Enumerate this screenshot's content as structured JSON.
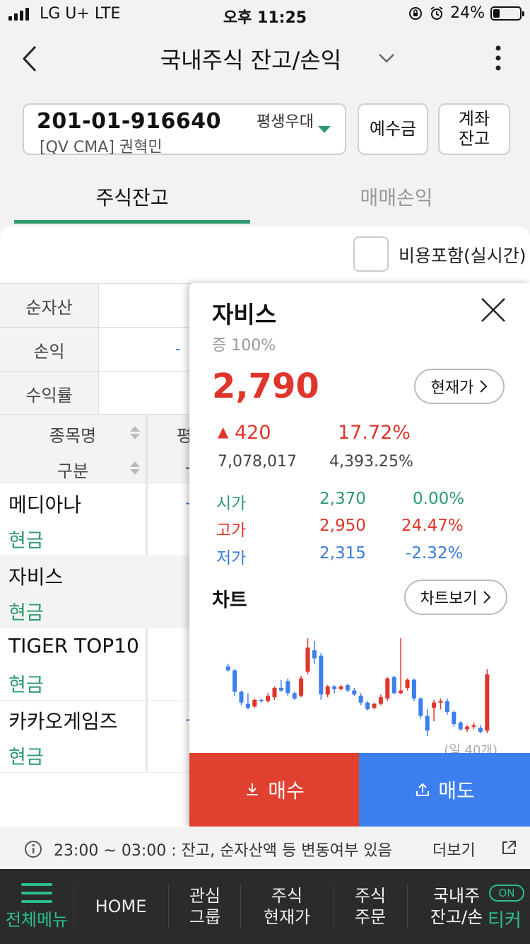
{
  "status_bar": {
    "carrier": "LG U+  LTE",
    "time": "오후 11:25",
    "battery": "24%",
    "battery_level": 0.24
  },
  "header": {
    "title": "국내주식 잔고/손익"
  },
  "account": {
    "number": "201-01-916640",
    "branch": "평생우대",
    "type_name": "[QV CMA]  권혁민",
    "deposit_btn": "예수금",
    "balance_btn": "계좌\n잔고"
  },
  "tabs": [
    {
      "label": "주식잔고",
      "active": true
    },
    {
      "label": "매매손익",
      "active": false
    }
  ],
  "include_fee_label": "비용포함(실시간)",
  "summary": [
    {
      "label": "순자산",
      "value": ""
    },
    {
      "label": "손익",
      "value": "-"
    },
    {
      "label": "수익률",
      "value": ""
    }
  ],
  "stock_table": {
    "header_name": "종목명",
    "header_type": "구분",
    "header_col2_a": "평",
    "header_col2_b": "-",
    "rows": [
      {
        "name": "메디아나",
        "type": "현금",
        "col2": "-"
      },
      {
        "name": "자비스",
        "type": "현금",
        "col2": ""
      },
      {
        "name": "TIGER TOP10",
        "type": "현금",
        "col2": ""
      },
      {
        "name": "카카오게임즈",
        "type": "현금",
        "col2": "-"
      }
    ]
  },
  "popup": {
    "name": "자비스",
    "margin": "증 100%",
    "price": "2,790",
    "current_btn": "현재가",
    "change": "420",
    "change_pct": "17.72%",
    "volume": "7,078,017",
    "volume_pct": "4,393.25%",
    "ohlc": [
      {
        "label": "시가",
        "value": "2,370",
        "pct": "0.00%",
        "color": "#2d9a6e"
      },
      {
        "label": "고가",
        "value": "2,950",
        "pct": "24.47%",
        "color": "#e0352b"
      },
      {
        "label": "저가",
        "value": "2,315",
        "pct": "-2.32%",
        "color": "#3a7be0"
      }
    ],
    "chart_title": "차트",
    "chart_btn": "차트보기",
    "chart_footer": "(일 40개)",
    "buy_btn": "매수",
    "sell_btn": "매도",
    "colors": {
      "up": "#e0352b",
      "down": "#3d7fef"
    }
  },
  "info": {
    "text": "23:00 ~ 03:00 : 잔고, 순자산액 등 변동여부 있음",
    "more": "더보기"
  },
  "bottom_nav": {
    "all_menu": "전체메뉴",
    "items": [
      "HOME",
      "관심\n그룹",
      "주식\n현재가",
      "주식\n주문",
      "국내주\n잔고/손"
    ],
    "on_badge": "ON",
    "ticker": "티커"
  },
  "chart_data": {
    "type": "candlestick",
    "period": "daily",
    "count": 40,
    "candles": [
      {
        "o": 2440,
        "h": 2460,
        "l": 2400,
        "c": 2410
      },
      {
        "o": 2410,
        "h": 2420,
        "l": 2220,
        "c": 2250
      },
      {
        "o": 2250,
        "h": 2260,
        "l": 2150,
        "c": 2170
      },
      {
        "o": 2160,
        "h": 2240,
        "l": 2120,
        "c": 2130
      },
      {
        "o": 2140,
        "h": 2200,
        "l": 2130,
        "c": 2190
      },
      {
        "o": 2190,
        "h": 2200,
        "l": 2170,
        "c": 2180
      },
      {
        "o": 2180,
        "h": 2240,
        "l": 2170,
        "c": 2220
      },
      {
        "o": 2210,
        "h": 2290,
        "l": 2190,
        "c": 2280
      },
      {
        "o": 2280,
        "h": 2340,
        "l": 2250,
        "c": 2260
      },
      {
        "o": 2330,
        "h": 2350,
        "l": 2220,
        "c": 2240
      },
      {
        "o": 2240,
        "h": 2250,
        "l": 2190,
        "c": 2200
      },
      {
        "o": 2220,
        "h": 2370,
        "l": 2210,
        "c": 2350
      },
      {
        "o": 2400,
        "h": 2650,
        "l": 2380,
        "c": 2580
      },
      {
        "o": 2560,
        "h": 2630,
        "l": 2460,
        "c": 2500
      },
      {
        "o": 2520,
        "h": 2540,
        "l": 2190,
        "c": 2230
      },
      {
        "o": 2230,
        "h": 2300,
        "l": 2210,
        "c": 2290
      },
      {
        "o": 2290,
        "h": 2300,
        "l": 2240,
        "c": 2270
      },
      {
        "o": 2270,
        "h": 2300,
        "l": 2260,
        "c": 2290
      },
      {
        "o": 2300,
        "h": 2310,
        "l": 2250,
        "c": 2260
      },
      {
        "o": 2260,
        "h": 2280,
        "l": 2220,
        "c": 2230
      },
      {
        "o": 2220,
        "h": 2240,
        "l": 2150,
        "c": 2170
      },
      {
        "o": 2170,
        "h": 2180,
        "l": 2110,
        "c": 2120
      },
      {
        "o": 2130,
        "h": 2170,
        "l": 2120,
        "c": 2160
      },
      {
        "o": 2160,
        "h": 2230,
        "l": 2150,
        "c": 2210
      },
      {
        "o": 2200,
        "h": 2360,
        "l": 2180,
        "c": 2350
      },
      {
        "o": 2360,
        "h": 2370,
        "l": 2230,
        "c": 2240
      },
      {
        "o": 2240,
        "h": 2650,
        "l": 2230,
        "c": 2260
      },
      {
        "o": 2280,
        "h": 2350,
        "l": 2260,
        "c": 2340
      },
      {
        "o": 2340,
        "h": 2350,
        "l": 2180,
        "c": 2200
      },
      {
        "o": 2200,
        "h": 2210,
        "l": 2050,
        "c": 2070
      },
      {
        "o": 2070,
        "h": 2120,
        "l": 1920,
        "c": 1960
      },
      {
        "o": 2130,
        "h": 2190,
        "l": 2030,
        "c": 2170
      },
      {
        "o": 2170,
        "h": 2200,
        "l": 2120,
        "c": 2180
      },
      {
        "o": 2180,
        "h": 2200,
        "l": 2080,
        "c": 2100
      },
      {
        "o": 2100,
        "h": 2110,
        "l": 1990,
        "c": 2010
      },
      {
        "o": 2020,
        "h": 2030,
        "l": 1960,
        "c": 1970
      },
      {
        "o": 1970,
        "h": 2000,
        "l": 1950,
        "c": 1990
      },
      {
        "o": 1990,
        "h": 2020,
        "l": 1970,
        "c": 2000
      },
      {
        "o": 1980,
        "h": 2000,
        "l": 1940,
        "c": 1950
      },
      {
        "o": 1960,
        "h": 2420,
        "l": 1940,
        "c": 2380
      }
    ]
  }
}
